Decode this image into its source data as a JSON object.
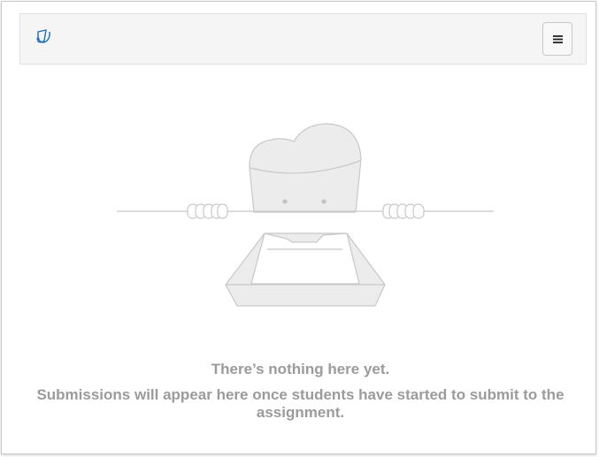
{
  "header": {
    "logo_icon": "app-logo-icon",
    "menu_icon": "hamburger-menu-icon"
  },
  "empty_state": {
    "illustration_icon": "empty-tray-illustration",
    "title": "There’s nothing here yet.",
    "message": "Submissions will appear here once students have started to submit to the assignment."
  },
  "colors": {
    "logo": "#1f6fb5",
    "text_muted": "#9b9b9b",
    "illustration_stroke": "#c8c8c8",
    "illustration_fill": "#ececec"
  }
}
